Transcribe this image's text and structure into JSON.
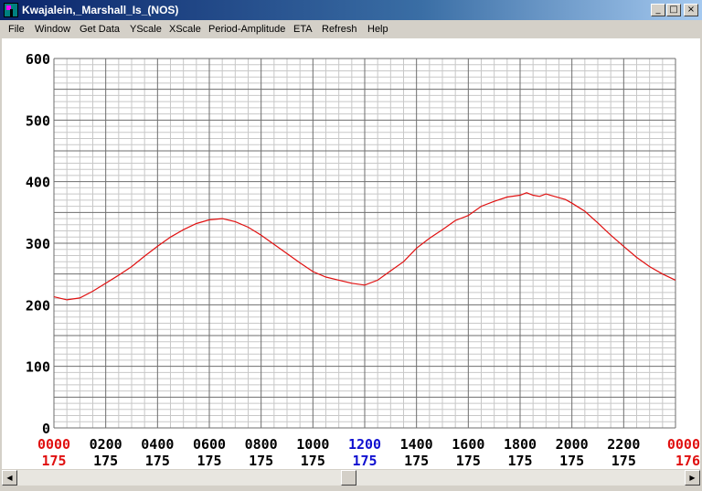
{
  "window": {
    "title": "Kwajalein,_Marshall_Is_(NOS)"
  },
  "menu": [
    "File",
    "Window",
    "Get Data",
    "YScale",
    "XScale",
    "Period-Amplitude",
    "ETA",
    "Refresh",
    "Help"
  ],
  "window_buttons": {
    "minimize": "_",
    "maximize": "□",
    "close": "×"
  },
  "colors": {
    "line": "#e01010",
    "grid_major": "#6e6e6e",
    "grid_minor": "#c8c8c8",
    "highlight": "#1010d0",
    "edge": "#e01010"
  },
  "chart_data": {
    "type": "line",
    "title": "",
    "ylim": [
      0,
      600
    ],
    "xlim": [
      0,
      24
    ],
    "y_ticks": [
      "0",
      "100",
      "200",
      "300",
      "400",
      "500",
      "600"
    ],
    "x_time_labels": [
      "0000",
      "0200",
      "0400",
      "0600",
      "0800",
      "1000",
      "1200",
      "1400",
      "1600",
      "1800",
      "2000",
      "2200",
      "0000"
    ],
    "x_day_labels": [
      "175",
      "175",
      "175",
      "175",
      "175",
      "175",
      "175",
      "175",
      "175",
      "175",
      "175",
      "175",
      "176"
    ],
    "x_label_colors": [
      "#e01010",
      "#000000",
      "#000000",
      "#000000",
      "#000000",
      "#000000",
      "#1010d0",
      "#000000",
      "#000000",
      "#000000",
      "#000000",
      "#000000",
      "#e01010"
    ],
    "series": [
      {
        "x": [
          0,
          0.5,
          1,
          1.5,
          2,
          2.5,
          3,
          3.5,
          4,
          4.5,
          5,
          5.5,
          6,
          6.5,
          7,
          7.5,
          8,
          8.5,
          9,
          9.5,
          10,
          10.5,
          11,
          11.5,
          12,
          12.5,
          13,
          13.5,
          14,
          14.5,
          15,
          15.5,
          16,
          16.5,
          17,
          17.5,
          18,
          18.25,
          18.5,
          18.75,
          19,
          19.25,
          19.5,
          19.75,
          20,
          20.5,
          21,
          21.5,
          22,
          22.5,
          23,
          23.5,
          24
        ],
        "y": [
          213,
          208,
          211,
          222,
          235,
          248,
          262,
          279,
          295,
          310,
          322,
          332,
          338,
          340,
          335,
          326,
          313,
          298,
          283,
          268,
          254,
          245,
          240,
          235,
          232,
          240,
          255,
          270,
          292,
          308,
          322,
          337,
          345,
          360,
          368,
          375,
          378,
          382,
          378,
          376,
          380,
          377,
          374,
          371,
          365,
          352,
          333,
          313,
          295,
          277,
          262,
          250,
          240
        ]
      }
    ]
  }
}
